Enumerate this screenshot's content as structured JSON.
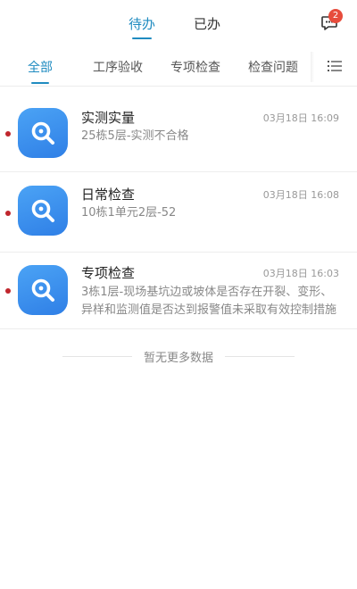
{
  "header": {
    "tabs": [
      {
        "label": "待办",
        "active": true
      },
      {
        "label": "已办",
        "active": false
      }
    ],
    "message_badge": "2"
  },
  "sub_tabs": [
    {
      "label": "全部",
      "active": true
    },
    {
      "label": "工序验收",
      "active": false
    },
    {
      "label": "专项检查",
      "active": false
    },
    {
      "label": "检查问题",
      "active": false
    }
  ],
  "tasks": [
    {
      "title": "实测实量",
      "time": "03月18日 16:09",
      "desc": "25栋5层-实测不合格",
      "unread": true
    },
    {
      "title": "日常检查",
      "time": "03月18日 16:08",
      "desc": "10栋1单元2层-52",
      "unread": true
    },
    {
      "title": "专项检查",
      "time": "03月18日 16:03",
      "desc": "3栋1层-现场基坑边或坡体是否存在开裂、变形、异样和监测值是否达到报警值未采取有效控制措施",
      "unread": true
    }
  ],
  "footer": {
    "no_more": "暂无更多数据"
  },
  "colors": {
    "accent": "#1f8bc0",
    "badge": "#e74c3c",
    "unread_dot": "#c0262d",
    "icon_bg": "#3a8cf0"
  },
  "icons": {
    "message": "chat-bubble-icon",
    "list": "list-menu-icon",
    "task": "search-magnifier-icon"
  }
}
